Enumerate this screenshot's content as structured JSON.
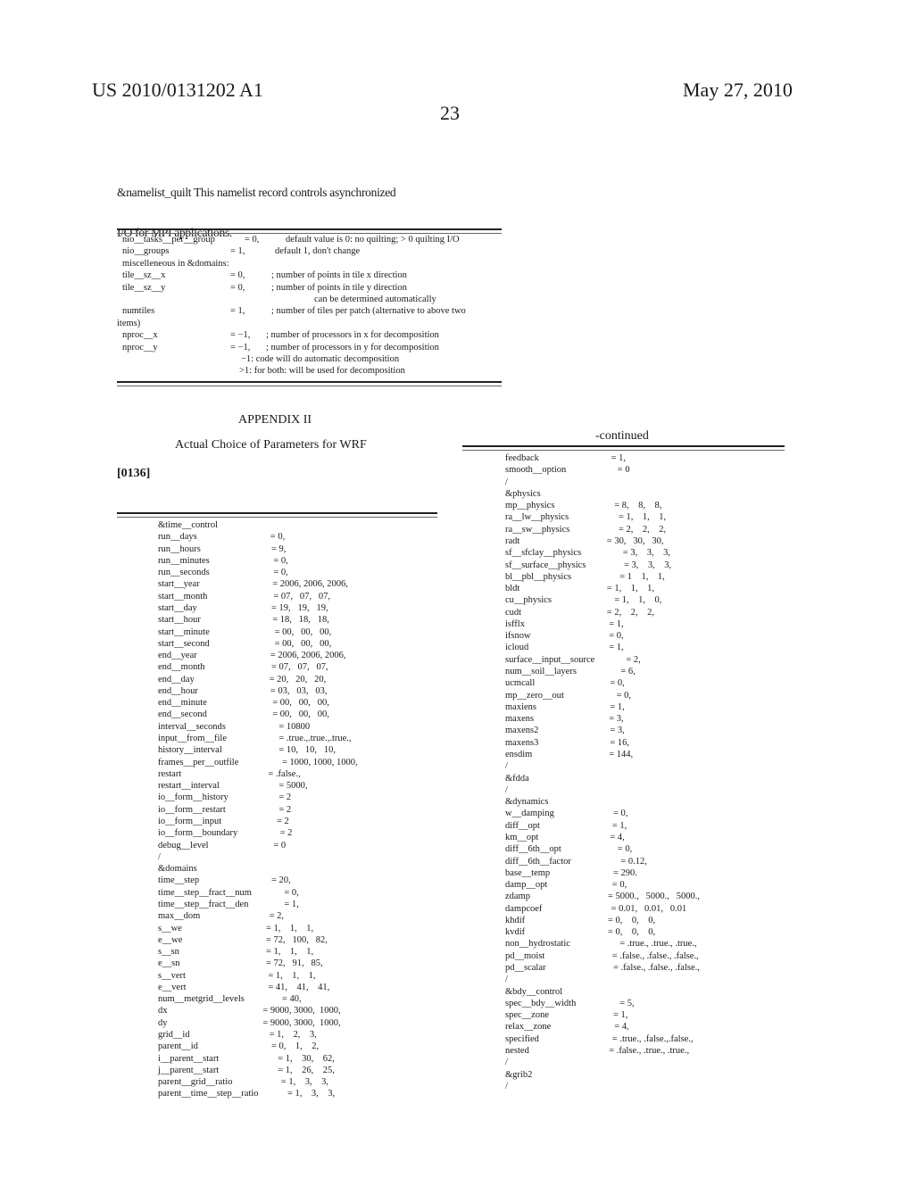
{
  "header": {
    "patent_number": "US 2010/0131202 A1",
    "date": "May 27, 2010",
    "page_number": "23"
  },
  "intro": {
    "line1": "&namelist_quilt This namelist record controls asynchronized",
    "line2": "I/O for MPI applications."
  },
  "quilt_table": [
    {
      "name": "nio__tasks__per__group",
      "value": "= 0,",
      "comment": "default value is 0: no quilting; > 0 quilting I/O"
    },
    {
      "name": "nio__groups",
      "value": "= 1,",
      "comment": "default 1, don't change"
    },
    {
      "name": "miscelleneous in &domains:",
      "value": "",
      "comment": ""
    },
    {
      "name": "tile__sz__x",
      "value": "= 0,",
      "comment": "; number of points in tile x direction"
    },
    {
      "name": "tile__sz__y",
      "value": "= 0,",
      "comment": "; number of points in tile y direction"
    },
    {
      "name": "",
      "value": "",
      "comment": "can be determined automatically"
    },
    {
      "name": "numtiles",
      "value": "= 1,",
      "comment": "; number of tiles per patch (alternative to above two"
    },
    {
      "name": "items)",
      "value": "",
      "comment": ""
    },
    {
      "name": "nproc__x",
      "value": "= −1,",
      "comment": "; number of processors in x for decomposition"
    },
    {
      "name": "nproc__y",
      "value": "= −1,",
      "comment": "; number of processors in y for decomposition"
    },
    {
      "name": "",
      "value": "",
      "comment": "−1: code will do automatic decomposition"
    },
    {
      "name": "",
      "value": "",
      "comment": ">1: for both: will be used for decomposition"
    }
  ],
  "appendix": {
    "title": "APPENDIX II",
    "subtitle": "Actual Choice of Parameters for WRF",
    "paragraph": "[0136]",
    "continued_label": "-continued"
  },
  "left_column": [
    {
      "name": "&time__control",
      "value": ""
    },
    {
      "name": "run__days",
      "value": "= 0,"
    },
    {
      "name": "run__hours",
      "value": "= 9,"
    },
    {
      "name": "run__minutes",
      "value": "= 0,"
    },
    {
      "name": "run__seconds",
      "value": "= 0,"
    },
    {
      "name": "start__year",
      "value": "= 2006, 2006, 2006,"
    },
    {
      "name": "start__month",
      "value": "= 07,   07,   07,"
    },
    {
      "name": "start__day",
      "value": "= 19,   19,   19,"
    },
    {
      "name": "start__hour",
      "value": "= 18,   18,   18,"
    },
    {
      "name": "start__minute",
      "value": "= 00,   00,   00,"
    },
    {
      "name": "start__second",
      "value": "= 00,   00,   00,"
    },
    {
      "name": "end__year",
      "value": "= 2006, 2006, 2006,"
    },
    {
      "name": "end__month",
      "value": "= 07,   07,   07,"
    },
    {
      "name": "end__day",
      "value": "= 20,   20,   20,"
    },
    {
      "name": "end__hour",
      "value": "= 03,   03,   03,"
    },
    {
      "name": "end__minute",
      "value": "= 00,   00,   00,"
    },
    {
      "name": "end__second",
      "value": "= 00,   00,   00,"
    },
    {
      "name": "interval__seconds",
      "value": "= 10800"
    },
    {
      "name": "input__from__file",
      "value": "= .true.,.true.,.true.,"
    },
    {
      "name": "history__interval",
      "value": "= 10,   10,   10,"
    },
    {
      "name": "frames__per__outfile",
      "value": "= 1000, 1000, 1000,"
    },
    {
      "name": "restart",
      "value": "= .false.,"
    },
    {
      "name": "restart__interval",
      "value": "= 5000,"
    },
    {
      "name": "io__form__history",
      "value": "= 2"
    },
    {
      "name": "io__form__restart",
      "value": "= 2"
    },
    {
      "name": "io__form__input",
      "value": "= 2"
    },
    {
      "name": "io__form__boundary",
      "value": "= 2"
    },
    {
      "name": "debug__level",
      "value": "= 0"
    },
    {
      "name": "/",
      "value": ""
    },
    {
      "name": "&domains",
      "value": ""
    },
    {
      "name": "time__step",
      "value": "= 20,"
    },
    {
      "name": "time__step__fract__num",
      "value": "= 0,"
    },
    {
      "name": "time__step__fract__den",
      "value": "= 1,"
    },
    {
      "name": "max__dom",
      "value": "= 2,"
    },
    {
      "name": "s__we",
      "value": "= 1,    1,    1,"
    },
    {
      "name": "e__we",
      "value": "= 72,   100,   82,"
    },
    {
      "name": "s__sn",
      "value": "= 1,    1,    1,"
    },
    {
      "name": "e__sn",
      "value": "= 72,   91,   85,"
    },
    {
      "name": "s__vert",
      "value": "= 1,    1,    1,"
    },
    {
      "name": "e__vert",
      "value": "= 41,    41,    41,"
    },
    {
      "name": "num__metgrid__levels",
      "value": "= 40,"
    },
    {
      "name": "dx",
      "value": "= 9000, 3000,  1000,"
    },
    {
      "name": "dy",
      "value": "= 9000, 3000,  1000,"
    },
    {
      "name": "grid__id",
      "value": "= 1,    2,    3,"
    },
    {
      "name": "parent__id",
      "value": "= 0,    1,    2,"
    },
    {
      "name": "i__parent__start",
      "value": "= 1,    30,    62,"
    },
    {
      "name": "j__parent__start",
      "value": "= 1,    26,    25,"
    },
    {
      "name": "parent__grid__ratio",
      "value": "= 1,    3,    3,"
    },
    {
      "name": "parent__time__step__ratio",
      "value": "= 1,    3,    3,"
    }
  ],
  "right_column": [
    {
      "name": "feedback",
      "value": "= 1,"
    },
    {
      "name": "smooth__option",
      "value": "= 0"
    },
    {
      "name": "/",
      "value": ""
    },
    {
      "name": "&physics",
      "value": ""
    },
    {
      "name": "mp__physics",
      "value": "= 8,    8,    8,"
    },
    {
      "name": "ra__lw__physics",
      "value": "= 1,    1,    1,"
    },
    {
      "name": "ra__sw__physics",
      "value": "= 2,    2,    2,"
    },
    {
      "name": "radt",
      "value": "= 30,   30,   30,"
    },
    {
      "name": "sf__sfclay__physics",
      "value": "= 3,    3,    3,"
    },
    {
      "name": "sf__surface__physics",
      "value": "= 3,    3,    3,"
    },
    {
      "name": "bl__pbl__physics",
      "value": "= 1    1,    1,"
    },
    {
      "name": "bldt",
      "value": "= 1,    1,    1,"
    },
    {
      "name": "cu__physics",
      "value": "= 1,    1,    0,"
    },
    {
      "name": "cudt",
      "value": "= 2,    2,    2,"
    },
    {
      "name": "isfflx",
      "value": "= 1,"
    },
    {
      "name": "ifsnow",
      "value": "= 0,"
    },
    {
      "name": "icloud",
      "value": "= 1,"
    },
    {
      "name": "surface__input__source",
      "value": "= 2,"
    },
    {
      "name": "num__soil__layers",
      "value": "= 6,"
    },
    {
      "name": "ucmcall",
      "value": "= 0,"
    },
    {
      "name": "mp__zero__out",
      "value": "= 0,"
    },
    {
      "name": "maxiens",
      "value": "= 1,"
    },
    {
      "name": "maxens",
      "value": "= 3,"
    },
    {
      "name": "maxens2",
      "value": "= 3,"
    },
    {
      "name": "maxens3",
      "value": "= 16,"
    },
    {
      "name": "ensdim",
      "value": "= 144,"
    },
    {
      "name": "/",
      "value": ""
    },
    {
      "name": "&fdda",
      "value": ""
    },
    {
      "name": "/",
      "value": ""
    },
    {
      "name": "&dynamics",
      "value": ""
    },
    {
      "name": "w__damping",
      "value": "= 0,"
    },
    {
      "name": "diff__opt",
      "value": "= 1,"
    },
    {
      "name": "km__opt",
      "value": "= 4,"
    },
    {
      "name": "diff__6th__opt",
      "value": "= 0,"
    },
    {
      "name": "diff__6th__factor",
      "value": "= 0.12,"
    },
    {
      "name": "base__temp",
      "value": "= 290."
    },
    {
      "name": "damp__opt",
      "value": "= 0,"
    },
    {
      "name": "zdamp",
      "value": "= 5000.,   5000.,   5000.,"
    },
    {
      "name": "dampcoef",
      "value": "= 0.01,   0.01,   0.01"
    },
    {
      "name": "khdif",
      "value": "= 0,    0,    0,"
    },
    {
      "name": "kvdif",
      "value": "= 0,    0,    0,"
    },
    {
      "name": "non__hydrostatic",
      "value": "= .true., .true., .true.,"
    },
    {
      "name": "pd__moist",
      "value": "= .false., .false., .false.,"
    },
    {
      "name": "pd__scalar",
      "value": "= .false., .false., .false.,"
    },
    {
      "name": "/",
      "value": ""
    },
    {
      "name": "&bdy__control",
      "value": ""
    },
    {
      "name": "spec__bdy__width",
      "value": "= 5,"
    },
    {
      "name": "spec__zone",
      "value": "= 1,"
    },
    {
      "name": "relax__zone",
      "value": "= 4,"
    },
    {
      "name": "specified",
      "value": "= .true., .false.,.false.,"
    },
    {
      "name": "nested",
      "value": "= .false., .true., .true.,"
    },
    {
      "name": "/",
      "value": ""
    },
    {
      "name": "&grib2",
      "value": ""
    },
    {
      "name": "/",
      "value": ""
    }
  ]
}
